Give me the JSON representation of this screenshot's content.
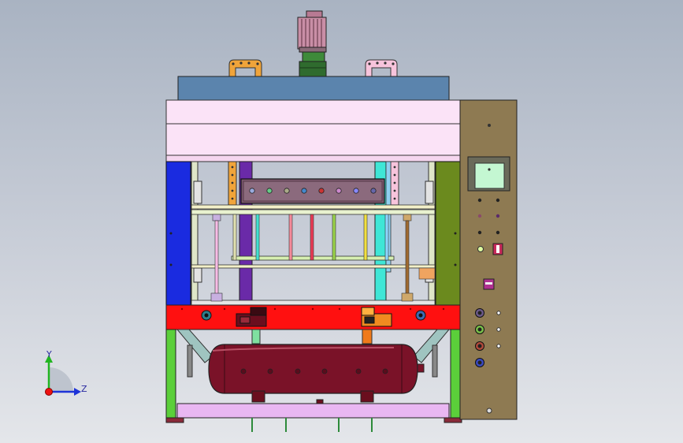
{
  "viewport": {
    "background_top": "#a9b3c2",
    "background_bottom": "#e4e6ea"
  },
  "model": {
    "frame_color": "#5bcf3a",
    "top_cover_color": "#5b84ad",
    "canopy_color": "#fbe3f7",
    "base_beam_color": "#ff1010",
    "tank_color": "#7a1228",
    "control_cabinet_color": "#8e7a52",
    "left_panel_color": "#1a2be0",
    "right_panel_color": "#6b8a1e",
    "platen_color": "#7c5a6e",
    "base_plate_color": "#e9b7f2",
    "motor_color": "#c98ea6"
  },
  "triad": {
    "y_label": "Y",
    "z_label": "Z",
    "y_axis_color": "#21b521",
    "z_axis_color": "#1e33d8",
    "x_axis_color": "#e11"
  }
}
